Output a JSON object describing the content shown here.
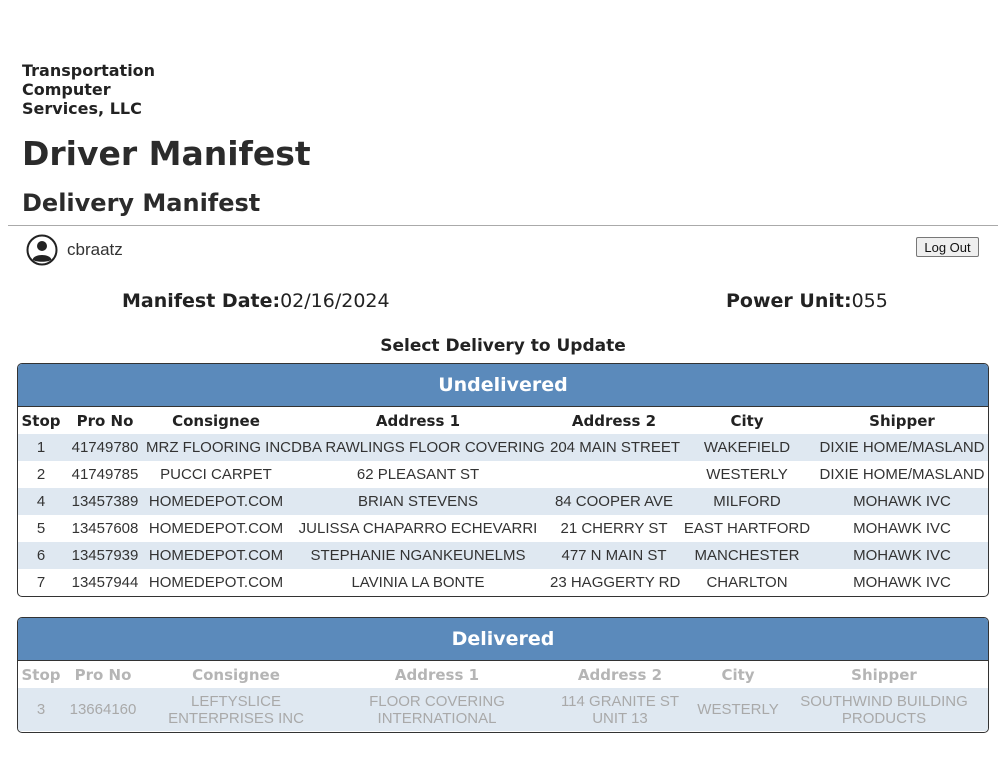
{
  "company": "Transportation Computer Services, LLC",
  "title": "Driver Manifest",
  "subtitle": "Delivery Manifest",
  "user": {
    "name": "cbraatz",
    "icon": "user-avatar-icon"
  },
  "logout_label": "Log Out",
  "manifest": {
    "date_label": "Manifest Date:",
    "date_value": "02/16/2024",
    "unit_label": "Power Unit:",
    "unit_value": "055"
  },
  "select_title": "Select Delivery to Update",
  "columns": [
    "Stop",
    "Pro No",
    "Consignee",
    "Address 1",
    "Address 2",
    "City",
    "Shipper"
  ],
  "undelivered": {
    "title": "Undelivered",
    "rows": [
      [
        "1",
        "41749780",
        "MRZ FLOORING INC",
        "DBA RAWLINGS FLOOR COVERING",
        "204 MAIN STREET",
        "WAKEFIELD",
        "DIXIE HOME/MASLAND"
      ],
      [
        "2",
        "41749785",
        "PUCCI CARPET",
        "62 PLEASANT ST",
        "",
        "WESTERLY",
        "DIXIE HOME/MASLAND"
      ],
      [
        "4",
        "13457389",
        "HOMEDEPOT.COM",
        "BRIAN STEVENS",
        "84 COOPER AVE",
        "MILFORD",
        "MOHAWK IVC"
      ],
      [
        "5",
        "13457608",
        "HOMEDEPOT.COM",
        "JULISSA CHAPARRO ECHEVARRI",
        "21 CHERRY ST",
        "EAST HARTFORD",
        "MOHAWK IVC"
      ],
      [
        "6",
        "13457939",
        "HOMEDEPOT.COM",
        "STEPHANIE NGANKEUNELMS",
        "477 N MAIN ST",
        "MANCHESTER",
        "MOHAWK IVC"
      ],
      [
        "7",
        "13457944",
        "HOMEDEPOT.COM",
        "LAVINIA LA BONTE",
        "23 HAGGERTY RD",
        "CHARLTON",
        "MOHAWK IVC"
      ]
    ]
  },
  "delivered": {
    "title": "Delivered",
    "rows": [
      [
        "3",
        "13664160",
        "LEFTYSLICE ENTERPRISES INC",
        "FLOOR COVERING INTERNATIONAL",
        "114 GRANITE ST UNIT 13",
        "WESTERLY",
        "SOUTHWIND BUILDING PRODUCTS"
      ]
    ]
  },
  "colors": {
    "panel_header": "#5b8abb",
    "row_alt": "#dfe8f1"
  }
}
